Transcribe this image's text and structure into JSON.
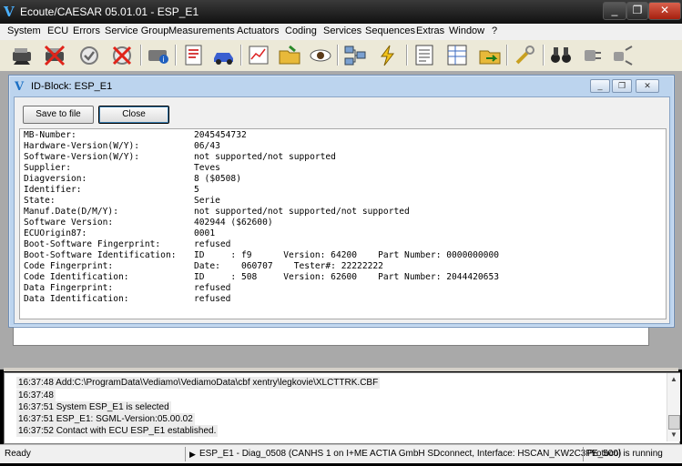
{
  "app": {
    "title": "Ecoute/CAESAR 05.01.01 - ESP_E1",
    "logo": "V"
  },
  "window_controls": {
    "minimize": "_",
    "restore": "❐",
    "close": "✕"
  },
  "menu": [
    "System",
    "ECU",
    "Errors",
    "Service Group",
    "Measurements",
    "Actuators",
    "Coding",
    "Services",
    "Sequences",
    "Extras",
    "Window",
    "?"
  ],
  "toolbar": {
    "icons": [
      "ecu-connect-icon",
      "ecu-disconnect-icon",
      "refresh-icon",
      "disconnect-icon",
      "device-info-icon",
      "report-icon",
      "car-icon",
      "measurement-chart-icon",
      "open-folder-icon",
      "view-eye-icon",
      "network-icon",
      "flash-icon",
      "document-list-icon",
      "grid-report-icon",
      "folder-export-icon",
      "tools-icon",
      "binoculars-icon",
      "plug-icon",
      "unplug-icon"
    ]
  },
  "child_window": {
    "title": "ID-Block: ESP_E1",
    "save_label": "Save to file",
    "close_label": "Close",
    "rows": [
      {
        "key": "MB-Number:",
        "value": "2045454732"
      },
      {
        "key": "Hardware-Version(W/Y):",
        "value": "06/43"
      },
      {
        "key": "Software-Version(W/Y):",
        "value": "not supported/not supported"
      },
      {
        "key": "Supplier:",
        "value": "Teves"
      },
      {
        "key": "Diagversion:",
        "value": "8 ($0508)"
      },
      {
        "key": "Identifier:",
        "value": "5"
      },
      {
        "key": "State:",
        "value": "Serie"
      },
      {
        "key": "Manuf.Date(D/M/Y):",
        "value": "not supported/not supported/not supported"
      },
      {
        "key": "Software Version:",
        "value": "402944 ($62600)"
      },
      {
        "key": "ECUOrigin87:",
        "value": "0001"
      },
      {
        "key": "Boot-Software Fingerprint:",
        "value": "refused"
      },
      {
        "key": "Boot-Software Identification:",
        "value": "ID     : f9      Version: 64200    Part Number: 0000000000"
      },
      {
        "key": "Code Fingerprint:",
        "value": "Date:    060707    Tester#: 22222222"
      },
      {
        "key": "Code Identification:",
        "value": "ID     : 508     Version: 62600    Part Number: 2044420653"
      },
      {
        "key": "Data Fingerprint:",
        "value": "refused"
      },
      {
        "key": "Data Identification:",
        "value": "refused"
      }
    ]
  },
  "log": [
    "16:37:48 Add:C:\\ProgramData\\Vediamo\\VediamoData\\cbf xentry\\legkovie\\XLCTTRK.CBF",
    "16:37:48",
    "16:37:51 System ESP_E1 is selected",
    "16:37:51 ESP_E1: SGML-Version:05.00.02",
    "16:37:52 Contact with ECU ESP_E1 established."
  ],
  "status": {
    "ready": "Ready",
    "connection": "ESP_E1 - Diag_0508 (CANHS 1 on I+ME ACTIA GmbH SDconnect, Interface: HSCAN_KW2C3PE_500)",
    "protocol": "Protocol is running"
  }
}
